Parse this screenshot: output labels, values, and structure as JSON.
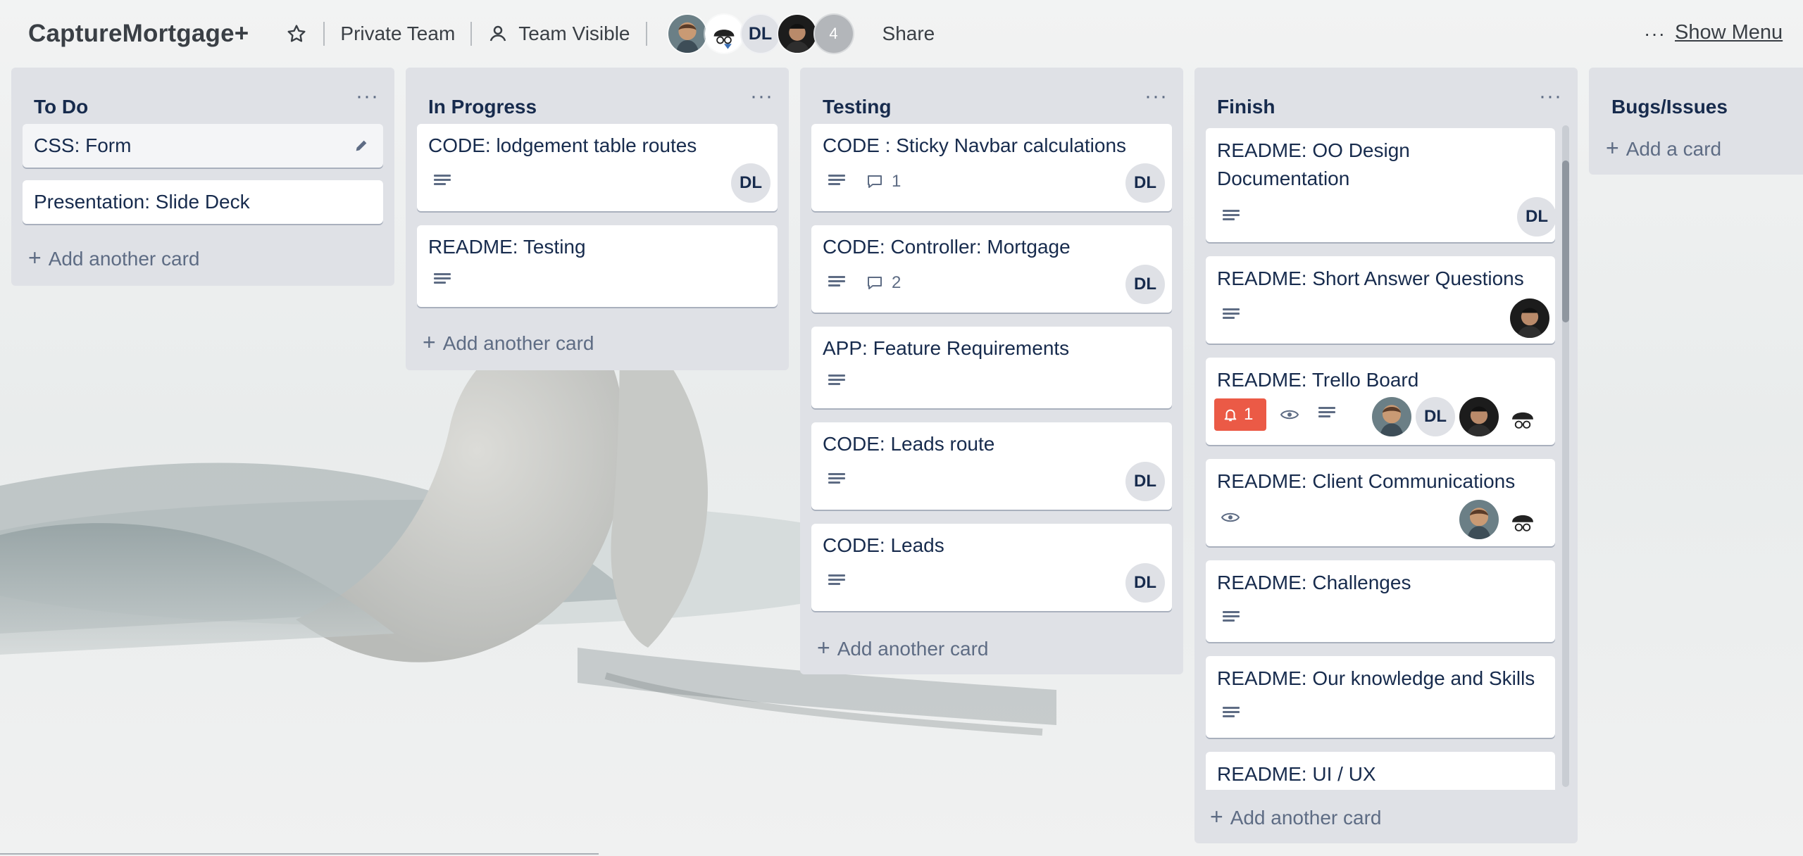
{
  "header": {
    "board_title": "CaptureMortgage+",
    "star_icon": "star-icon",
    "team_label": "Private Team",
    "visibility_label": "Team Visible",
    "members": [
      {
        "type": "photo",
        "icon": "member-avatar-photo"
      },
      {
        "type": "photo",
        "icon": "member-avatar-cartoon"
      },
      {
        "type": "initials",
        "label": "DL"
      },
      {
        "type": "photo",
        "icon": "member-avatar-photo"
      },
      {
        "type": "count",
        "label": "4"
      }
    ],
    "share_label": "Share",
    "menu_dots": "···",
    "show_menu_label": "Show Menu"
  },
  "lists": [
    {
      "title": "To Do",
      "menu": "···",
      "cards": [
        {
          "title": "CSS: Form"
        },
        {
          "title": "Presentation: Slide Deck"
        }
      ],
      "add_label": "Add another card"
    },
    {
      "title": "In Progress",
      "menu": "···",
      "cards": [
        {
          "title": "CODE: lodgement table routes",
          "avatar": "DL"
        },
        {
          "title": "README: Testing"
        }
      ],
      "add_label": "Add another card"
    },
    {
      "title": "Testing",
      "menu": "···",
      "cards": [
        {
          "title": "CODE : Sticky Navbar calculations",
          "comments": "1",
          "avatar": "DL"
        },
        {
          "title": "CODE: Controller: Mortgage",
          "comments": "2",
          "avatar": "DL"
        },
        {
          "title": "APP: Feature Requirements"
        },
        {
          "title": "CODE: Leads route",
          "avatar": "DL"
        },
        {
          "title": "CODE: Leads",
          "avatar": "DL"
        }
      ],
      "add_label": "Add another card"
    },
    {
      "title": "Finish",
      "menu": "···",
      "cards": [
        {
          "title_line1": "README: OO Design",
          "title_line2": "Documentation",
          "avatar": "DL"
        },
        {
          "title": "README: Short Answer Questions"
        },
        {
          "title": "README: Trello Board",
          "notifications": "1",
          "avatar": "DL"
        },
        {
          "title": "README: Client Communications"
        },
        {
          "title": "README: Challenges"
        },
        {
          "title": "README: Our knowledge and Skills"
        },
        {
          "title": "README: UI / UX"
        }
      ],
      "add_label": "Add another card"
    },
    {
      "title": "Bugs/Issues",
      "add_label": "Add a card"
    }
  ],
  "colors": {
    "list_bg": "#dfe1e6",
    "card_bg": "#ffffff",
    "alert": "#eb5a46",
    "text": "#172b4d",
    "muted": "#5e6c84"
  }
}
